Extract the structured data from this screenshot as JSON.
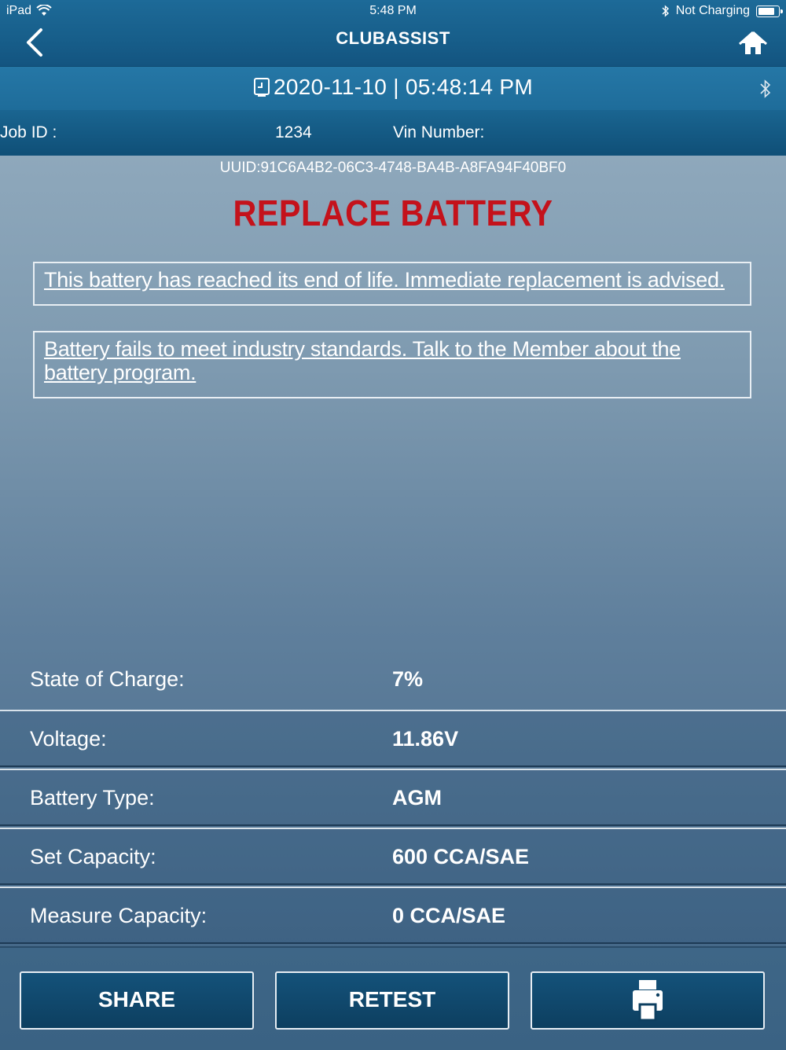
{
  "status_bar": {
    "device": "iPad",
    "time": "5:48 PM",
    "charging": "Not Charging"
  },
  "nav": {
    "logo": "CLUBASSIST"
  },
  "datebar": {
    "datetime": "2020-11-10 | 05:48:14 PM"
  },
  "job": {
    "job_id_label": "Job ID :",
    "job_id_value": "1234",
    "vin_label": "Vin Number:"
  },
  "uuid": "UUID:91C6A4B2-06C3-4748-BA4B-A8FA94F40BF0",
  "verdict": "REPLACE BATTERY",
  "messages": [
    "This battery has reached its end of life. Immediate replacement is advised.",
    "Battery fails to meet industry standards. Talk to the Member about the battery program."
  ],
  "results": [
    {
      "label": "State of Charge:",
      "value": "7%"
    },
    {
      "label": "Voltage:",
      "value": "11.86V"
    },
    {
      "label": "Battery Type:",
      "value": "AGM"
    },
    {
      "label": "Set Capacity:",
      "value": "600 CCA/SAE"
    },
    {
      "label": "Measure Capacity:",
      "value": "0 CCA/SAE"
    }
  ],
  "buttons": {
    "share": "SHARE",
    "retest": "RETEST"
  },
  "colors": {
    "header": "#175e8a",
    "verdict": "#c4121b"
  }
}
